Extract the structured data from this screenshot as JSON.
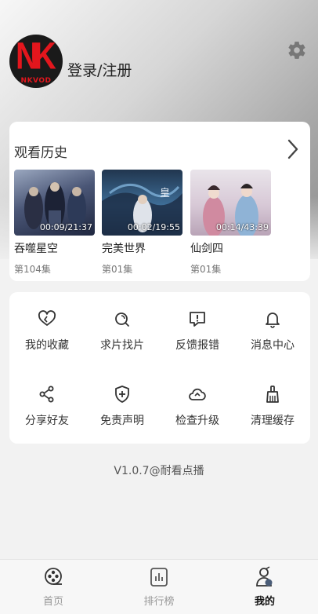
{
  "header": {
    "avatar_logo": "NK",
    "avatar_sub": "NKVOD",
    "login_label": "登录/注册",
    "settings_icon": "gear-icon"
  },
  "history": {
    "title": "观看历史",
    "items": [
      {
        "title": "吞噬星空",
        "episode": "第104集",
        "duration": "00:09/21:37",
        "thumb_color": "#3a4a66"
      },
      {
        "title": "完美世界",
        "episode": "第01集",
        "duration": "00:02/19:55",
        "thumb_color": "#2b5275"
      },
      {
        "title": "仙剑四",
        "episode": "第01集",
        "duration": "00:14/43:39",
        "thumb_color": "#c9b6c8"
      }
    ]
  },
  "menu": {
    "items": [
      {
        "label": "我的收藏",
        "icon": "heart-icon"
      },
      {
        "label": "求片找片",
        "icon": "search-film-icon"
      },
      {
        "label": "反馈报错",
        "icon": "feedback-icon"
      },
      {
        "label": "消息中心",
        "icon": "bell-icon"
      },
      {
        "label": "分享好友",
        "icon": "share-icon"
      },
      {
        "label": "免责声明",
        "icon": "shield-icon"
      },
      {
        "label": "检查升级",
        "icon": "cloud-icon"
      },
      {
        "label": "清理缓存",
        "icon": "broom-icon"
      }
    ]
  },
  "version": "V1.0.7@耐看点播",
  "tabs": [
    {
      "label": "首页",
      "icon": "film-reel-icon",
      "active": false
    },
    {
      "label": "排行榜",
      "icon": "chart-icon",
      "active": false
    },
    {
      "label": "我的",
      "icon": "user-icon",
      "active": true
    }
  ],
  "colors": {
    "brand_red": "#e3161d",
    "text": "#222222",
    "muted": "#999999"
  }
}
